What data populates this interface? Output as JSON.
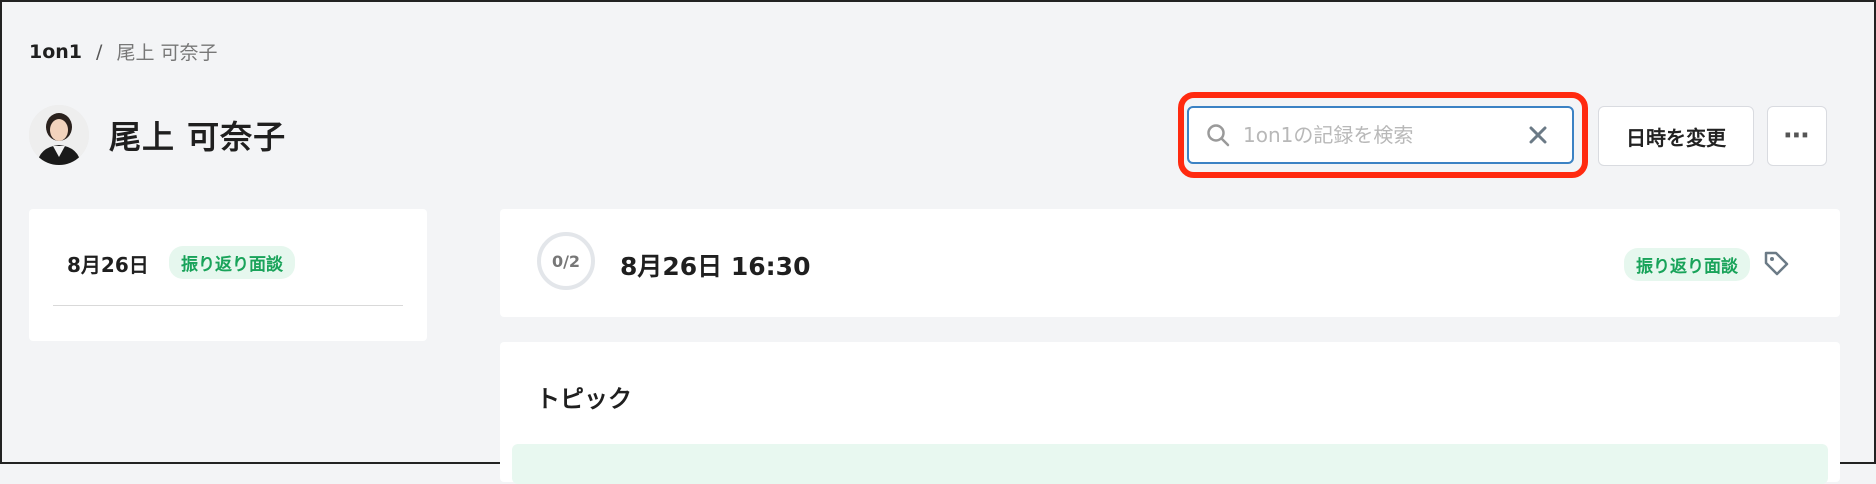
{
  "breadcrumb": {
    "root": "1on1",
    "separator": "/",
    "current": "尾上 可奈子"
  },
  "header": {
    "title": "尾上 可奈子"
  },
  "search": {
    "placeholder": "1on1の記録を検索",
    "value": ""
  },
  "actions": {
    "change_datetime": "日時を変更",
    "more": "⋯"
  },
  "sidebar": {
    "items": [
      {
        "date": "8月26日",
        "badge": "振り返り面談"
      }
    ]
  },
  "session": {
    "progress": "0/2",
    "datetime": "8月26日  16:30",
    "badge": "振り返り面談"
  },
  "topics": {
    "title": "トピック"
  },
  "colors": {
    "accent": "#3b82c4",
    "highlight": "#ff2a10",
    "badge_text": "#19a35a",
    "badge_bg": "#e6f7ee"
  },
  "icons": {
    "search": "search-icon",
    "clear": "close-icon",
    "tag": "tag-icon",
    "more": "ellipsis-icon"
  }
}
